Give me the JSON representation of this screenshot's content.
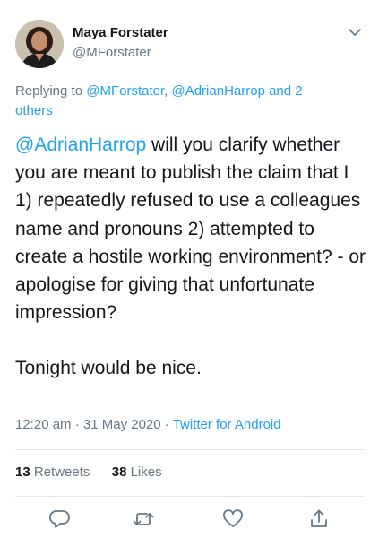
{
  "user": {
    "display_name": "Maya Forstater",
    "handle": "@MForstater"
  },
  "reply": {
    "prefix": "Replying to",
    "mention_1": "@MForstater",
    "separator": ",",
    "mention_2": "@AdrianHarrop",
    "connector": "and",
    "others": "2 others"
  },
  "tweet": {
    "mention": "@AdrianHarrop",
    "body": " will you clarify whether you are meant to publish the claim that I 1) repeatedly refused to use a colleagues name and pronouns 2) attempted to create a hostile working environment? - or apologise for giving that unfortunate impression?",
    "closing": "Tonight would be nice."
  },
  "meta": {
    "time": "12:20 am",
    "date": "31 May 2020",
    "dot": "·",
    "source": "Twitter for Android"
  },
  "stats": {
    "retweets_count": "13",
    "retweets_label": "Retweets",
    "likes_count": "38",
    "likes_label": "Likes"
  },
  "colors": {
    "link": "#1da1f2",
    "secondary_text": "#657786",
    "primary_text": "#14171a",
    "divider": "#e1e8ed"
  },
  "icons": [
    "chevron-down-icon",
    "reply-icon",
    "retweet-icon",
    "like-icon",
    "share-icon"
  ]
}
